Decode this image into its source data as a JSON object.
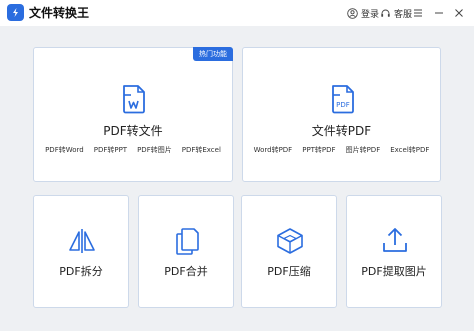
{
  "app": {
    "title": "文件转换王",
    "login_label": "登录",
    "service_label": "客服"
  },
  "cards": {
    "pdf_to_file": {
      "title": "PDF转文件",
      "badge": "热门功能",
      "options": [
        "PDF转Word",
        "PDF转PPT",
        "PDF转图片",
        "PDF转Excel"
      ]
    },
    "file_to_pdf": {
      "title": "文件转PDF",
      "options": [
        "Word转PDF",
        "PPT转PDF",
        "图片转PDF",
        "Excel转PDF"
      ]
    },
    "tools": [
      {
        "title": "PDF拆分",
        "icon": "split-icon"
      },
      {
        "title": "PDF合并",
        "icon": "merge-icon"
      },
      {
        "title": "PDF压缩",
        "icon": "compress-icon"
      },
      {
        "title": "PDF提取图片",
        "icon": "extract-icon"
      }
    ]
  },
  "colors": {
    "accent": "#2b6ddf",
    "background": "#eef0f3",
    "card_border": "#cdd9ea"
  }
}
